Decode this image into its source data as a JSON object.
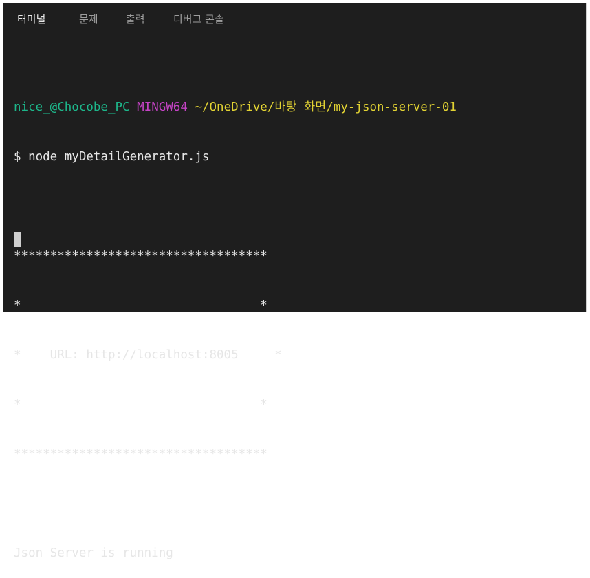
{
  "tabs": [
    {
      "label": "터미널",
      "active": true
    },
    {
      "label": "문제",
      "active": false
    },
    {
      "label": "출력",
      "active": false
    },
    {
      "label": "디버그 콘솔",
      "active": false
    }
  ],
  "terminal": {
    "prompt": {
      "user_host": "nice_@Chocobe_PC",
      "system": "MINGW64",
      "path": "~/OneDrive/바탕 화면/my-json-server-01"
    },
    "command": "$ node myDetailGenerator.js",
    "blank1": "",
    "banner": [
      "***********************************",
      "*                                 *",
      "*    URL: http://localhost:8005     *",
      "*                                 *",
      "***********************************"
    ],
    "blank2": "",
    "status": "Json Server is running"
  },
  "colors": {
    "background": "#1e1e1e",
    "user_host": "#1db68a",
    "system": "#c543c5",
    "path": "#e1d233",
    "text": "#e6e6e6"
  }
}
